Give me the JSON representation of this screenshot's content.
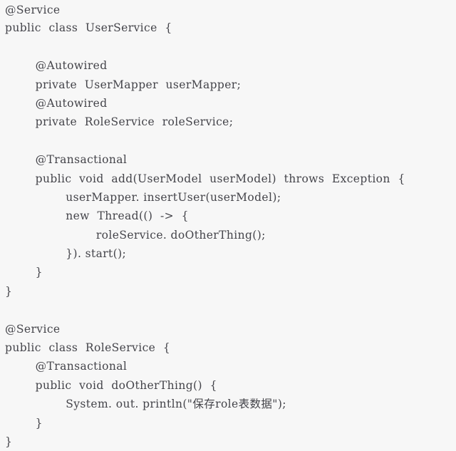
{
  "document": {
    "type": "code-snippet",
    "language": "Java",
    "background_color": "#f7f7f7",
    "text_color": "#44444a"
  },
  "code": {
    "lines": [
      "@Service",
      "public  class  UserService  {",
      "",
      "        @Autowired",
      "        private  UserMapper  userMapper;",
      "        @Autowired",
      "        private  RoleService  roleService;",
      "",
      "        @Transactional",
      "        public  void  add(UserModel  userModel)  throws  Exception  {",
      "                userMapper. insertUser(userModel);",
      "                new  Thread(()  ->  {",
      "                        roleService. doOtherThing();",
      "                }). start();",
      "        }",
      "}",
      "",
      "@Service",
      "public  class  RoleService  {",
      "        @Transactional",
      "        public  void  doOtherThing()  {",
      "                System. out. println(\"保存role表数据\");",
      "        }",
      "}"
    ]
  }
}
